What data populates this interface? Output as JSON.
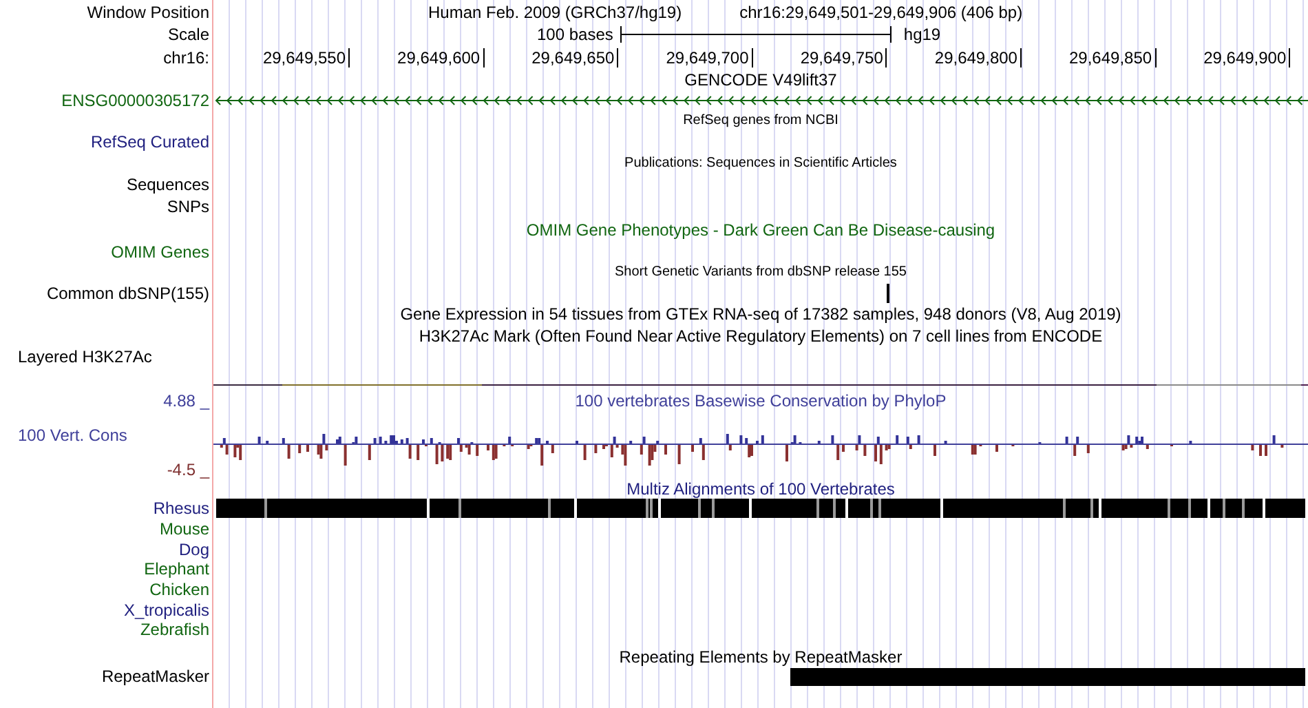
{
  "header": {
    "label": "Window Position",
    "assembly": "Human Feb. 2009 (GRCh37/hg19)",
    "position": "chr16:29,649,501-29,649,906 (406 bp)"
  },
  "scale": {
    "label": "Scale",
    "length": "100 bases",
    "assembly": "hg19"
  },
  "ruler": {
    "label": "chr16:",
    "ticks": [
      "29,649,550",
      "29,649,600",
      "29,649,650",
      "29,649,700",
      "29,649,750",
      "29,649,800",
      "29,649,850",
      "29,649,900"
    ]
  },
  "tracks": [
    {
      "kind": "gene",
      "title": {
        "text": "GENCODE V49lift37",
        "color": "#000000"
      },
      "label": "ENSG00000305172",
      "color": "#116611"
    },
    {
      "kind": "sparse",
      "title": {
        "text": "RefSeq genes from NCBI",
        "color": "#000000"
      },
      "label": "RefSeq Curated",
      "color": "#1f1f7f"
    },
    {
      "kind": "sparse",
      "title": {
        "text": "Publications: Sequences in Scientific Articles",
        "color": "#000000"
      },
      "label": "Sequences",
      "color": "#000000"
    },
    {
      "kind": "bare",
      "label": "SNPs",
      "color": "#000000"
    },
    {
      "kind": "plain",
      "title": {
        "text": "OMIM Gene Phenotypes - Dark Green Can Be Disease-causing",
        "color": "#116611"
      },
      "label": "OMIM Genes",
      "color": "#116611"
    },
    {
      "kind": "snp",
      "title": {
        "text": "Short Genetic Variants from dbSNP release 155",
        "color": "#000000"
      },
      "label": "Common dbSNP(155)",
      "color": "#000000"
    },
    {
      "kind": "caption",
      "title": {
        "text": "Gene Expression in 54 tissues from GTEx RNA-seq of 17382 samples, 948 donors (V8, Aug 2019)",
        "color": "#000000"
      }
    },
    {
      "kind": "signal",
      "title": {
        "text": "H3K27Ac Mark (Often Found Near Active Regulatory Elements) on 7 cell lines from ENCODE",
        "color": "#000000"
      },
      "label": "Layered H3K27Ac",
      "color": "#000000"
    },
    {
      "kind": "wiggle",
      "title": {
        "text": "100 vertebrates Basewise Conservation by PhyloP",
        "color": "#40409a"
      },
      "label": "100 Vert. Cons",
      "color": "#40409a",
      "max": "4.88 _",
      "min": "-4.5 _"
    },
    {
      "kind": "multiz",
      "title": {
        "text": "Multiz Alignments of 100 Vertebrates",
        "color": "#1f1f7f"
      },
      "species": [
        {
          "name": "Rhesus",
          "color": "#1f1f7f",
          "aligned": true
        },
        {
          "name": "Mouse",
          "color": "#116611",
          "aligned": false
        },
        {
          "name": "Dog",
          "color": "#1f1f7f",
          "aligned": false
        },
        {
          "name": "Elephant",
          "color": "#116611",
          "aligned": false
        },
        {
          "name": "Chicken",
          "color": "#116611",
          "aligned": false
        },
        {
          "name": "X_tropicalis",
          "color": "#1f1f7f",
          "aligned": false
        },
        {
          "name": "Zebrafish",
          "color": "#116611",
          "aligned": false
        }
      ]
    },
    {
      "kind": "repeat",
      "title": {
        "text": "Repeating Elements by RepeatMasker",
        "color": "#000000"
      },
      "label": "RepeatMasker",
      "color": "#000000"
    }
  ]
}
